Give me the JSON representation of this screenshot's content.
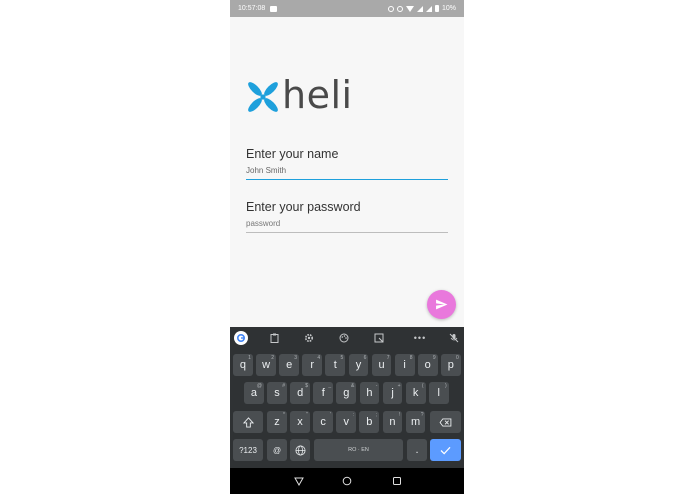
{
  "status_bar": {
    "time": "10:57:08",
    "battery": "10%",
    "icons": [
      "image-icon",
      "alarm-icon",
      "dnd-icon",
      "wifi-icon",
      "signal-icon",
      "signal-icon",
      "battery-icon"
    ]
  },
  "logo": {
    "text": "heli",
    "color": "#1ea0dc"
  },
  "form": {
    "name_label": "Enter your name",
    "name_value": "John Smith",
    "password_label": "Enter your password",
    "password_placeholder": "password"
  },
  "fab": {
    "icon": "send-icon",
    "color": "#e978dc"
  },
  "keyboard": {
    "toolbar": [
      "google-icon",
      "clipboard-icon",
      "settings-icon",
      "palette-icon",
      "resize-icon",
      "more-icon",
      "mic-off-icon"
    ],
    "row1": [
      {
        "k": "q",
        "h": "1"
      },
      {
        "k": "w",
        "h": "2"
      },
      {
        "k": "e",
        "h": "3"
      },
      {
        "k": "r",
        "h": "4"
      },
      {
        "k": "t",
        "h": "5"
      },
      {
        "k": "y",
        "h": "6"
      },
      {
        "k": "u",
        "h": "7"
      },
      {
        "k": "i",
        "h": "8"
      },
      {
        "k": "o",
        "h": "9"
      },
      {
        "k": "p",
        "h": "0"
      }
    ],
    "row2": [
      {
        "k": "a",
        "h": "@"
      },
      {
        "k": "s",
        "h": "#"
      },
      {
        "k": "d",
        "h": "$"
      },
      {
        "k": "f",
        "h": "_"
      },
      {
        "k": "g",
        "h": "&"
      },
      {
        "k": "h",
        "h": "-"
      },
      {
        "k": "j",
        "h": "+"
      },
      {
        "k": "k",
        "h": "("
      },
      {
        "k": "l",
        "h": ")"
      }
    ],
    "row3": [
      {
        "k": "z",
        "h": "*"
      },
      {
        "k": "x",
        "h": "\""
      },
      {
        "k": "c",
        "h": "'"
      },
      {
        "k": "v",
        "h": ":"
      },
      {
        "k": "b",
        "h": ";"
      },
      {
        "k": "n",
        "h": "!"
      },
      {
        "k": "m",
        "h": "?"
      }
    ],
    "symbols_label": "?123",
    "at_label": "@",
    "space_label": "RO · EN",
    "period_label": ".",
    "accent_color": "#5c9bff"
  },
  "nav_bar": {
    "icons": [
      "back-icon",
      "home-icon",
      "recents-icon"
    ]
  }
}
